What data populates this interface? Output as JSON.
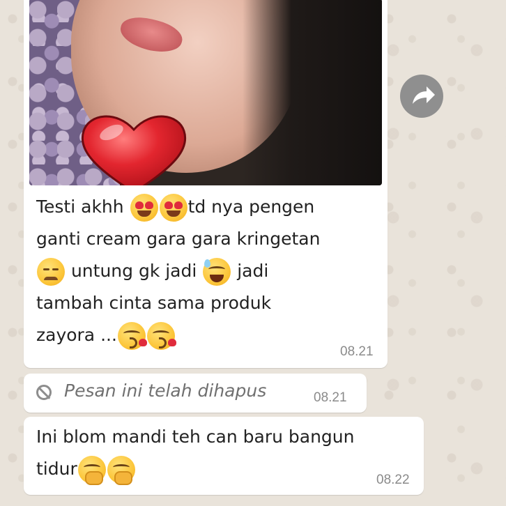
{
  "messages": [
    {
      "type": "image",
      "caption_lines": [
        {
          "parts": [
            "Testi akhh ",
            "",
            "td nya pengen"
          ]
        },
        {
          "parts": [
            "ganti cream gara gara kringetan"
          ]
        },
        {
          "parts": [
            "",
            " untung gk jadi ",
            " jadi"
          ]
        },
        {
          "parts": [
            "tambah cinta sama produk"
          ]
        },
        {
          "parts": [
            "zayora ..."
          ]
        }
      ],
      "emojis": [
        "smiling-face-with-heart-eyes",
        "smiling-face-with-heart-eyes",
        "disappointed-face",
        "grinning-face-with-sweat",
        "face-blowing-a-kiss",
        "face-blowing-a-kiss"
      ],
      "time": "08.21"
    },
    {
      "type": "deleted",
      "text": "Pesan ini telah dihapus",
      "time": "08.21"
    },
    {
      "type": "text",
      "line1": "Ini blom mandi teh can baru bangun",
      "line2": "tidur",
      "emojis": [
        "face-with-hand-over-mouth",
        "face-with-hand-over-mouth"
      ],
      "time": "08.22"
    }
  ],
  "icons": {
    "forward": "forward-arrow-icon",
    "deleted": "prohibited-icon"
  },
  "colors": {
    "bubble": "#ffffff",
    "wallpaper": "#e9e3da",
    "timestamp": "#8a8a8a",
    "heart": "#d81f2a"
  }
}
